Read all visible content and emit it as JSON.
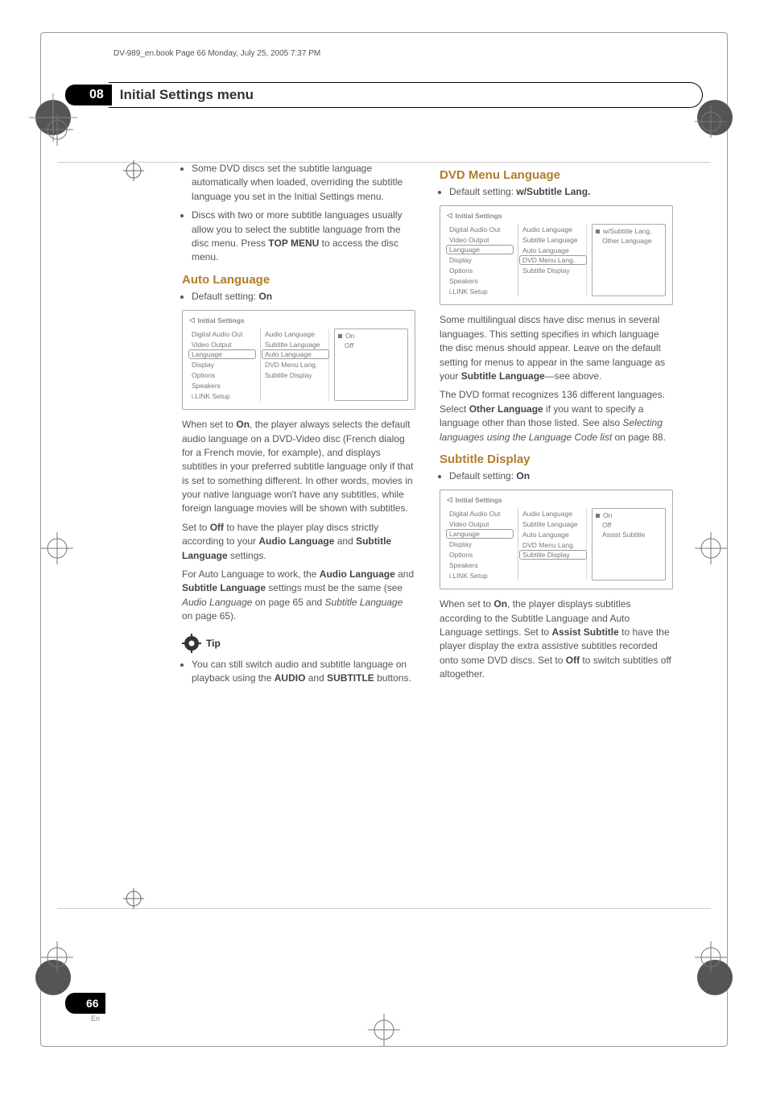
{
  "print_header": "DV-989_en.book  Page 66  Monday, July 25, 2005  7:37 PM",
  "chapter": {
    "number": "08",
    "title": "Initial Settings menu"
  },
  "left": {
    "intro_bullets": [
      "Some DVD discs set the subtitle language automatically when loaded, overriding the subtitle language you set in the Initial Settings menu.",
      "Discs with two or more subtitle languages usually allow you to select the subtitle language from the disc menu. Press TOP MENU to access the disc menu."
    ],
    "auto_language": {
      "heading": "Auto Language",
      "default_label": "Default setting: ",
      "default_value": "On",
      "para1_a": "When set to ",
      "para1_on": "On",
      "para1_b": ", the player always selects the default audio language on a DVD-Video disc (French dialog for a French movie, for example), and displays subtitles in your preferred subtitle language only if that is set to something different. In other words, movies in your native language won't have any subtitles, while foreign language movies will be shown with subtitles.",
      "para2_a": "Set to ",
      "para2_off": "Off",
      "para2_b": " to have the player play discs strictly according to your ",
      "para2_c": "Audio Language",
      "para2_d": " and ",
      "para2_e": "Subtitle Language",
      "para2_f": " settings.",
      "para3_a": "For Auto Language to work, the ",
      "para3_b": "Audio Language",
      "para3_c": " and ",
      "para3_d": "Subtitle Language",
      "para3_e": " settings must be the same (see ",
      "para3_f": "Audio Language",
      "para3_g": " on page 65 and ",
      "para3_h": "Subtitle Language",
      "para3_i": " on page 65)."
    },
    "tip": {
      "label": "Tip",
      "text_a": "You can still switch audio and subtitle language on playback using the ",
      "text_b": "AUDIO",
      "text_c": " and ",
      "text_d": "SUBTITLE",
      "text_e": " buttons."
    }
  },
  "right": {
    "dvd_menu_lang": {
      "heading": "DVD Menu Language",
      "default_label": "Default setting: ",
      "default_value": "w/Subtitle Lang.",
      "para1": "Some multilingual discs have disc menus in several languages. This setting specifies in which language the disc menus should appear. Leave on the default setting for menus to appear in the same language as your ",
      "para1_b": "Subtitle Language",
      "para1_c": "—see above.",
      "para2_a": "The DVD format recognizes 136 different languages. Select ",
      "para2_b": "Other Language",
      "para2_c": " if you want to specify a language other than those listed. See also ",
      "para2_d": "Selecting languages using the Language Code list",
      "para2_e": " on page 88."
    },
    "subtitle_display": {
      "heading": "Subtitle Display",
      "default_label": "Default setting: ",
      "default_value": "On",
      "para_a": "When set to ",
      "para_b": "On",
      "para_c": ", the player displays subtitles according to the Subtitle Language and Auto Language settings. Set to ",
      "para_d": "Assist Subtitle",
      "para_e": " to have the player display the extra assistive subtitles recorded onto some DVD discs. Set to ",
      "para_f": "Off",
      "para_g": " to switch subtitles off altogether."
    }
  },
  "osd": {
    "title": "Initial Settings",
    "left_items": [
      "Digital Audio Out",
      "Video Output",
      "Language",
      "Display",
      "Options",
      "Speakers",
      "i.LINK Setup"
    ],
    "mid_items": [
      "Audio Language",
      "Subtitle Language",
      "Auto Language",
      "DVD Menu Lang.",
      "Subtitle Display"
    ],
    "auto_lang_right": [
      "On",
      "Off"
    ],
    "dvd_menu_right": [
      "w/Subtitle Lang.",
      "Other Language"
    ],
    "subtitle_display_right": [
      "On",
      "Off",
      "Assist Subtitle"
    ]
  },
  "page_number": "66",
  "page_lang": "En"
}
